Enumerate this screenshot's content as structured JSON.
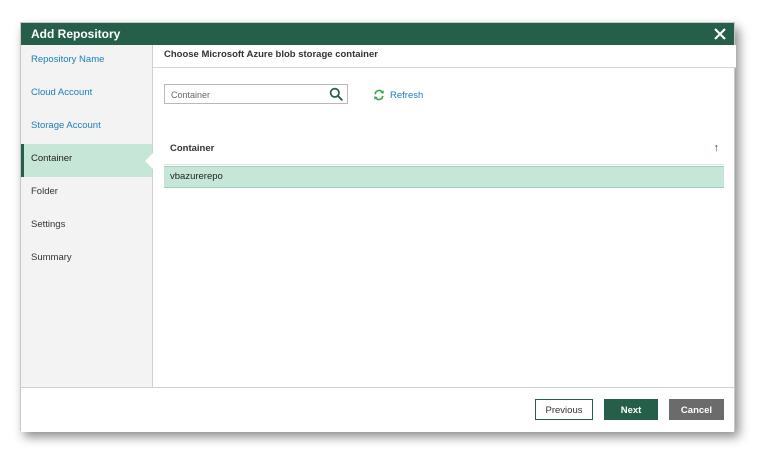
{
  "dialog": {
    "title": "Add Repository",
    "accent_color": "#255f4a"
  },
  "sidebar": {
    "items": [
      {
        "label": "Repository Name",
        "state": "done"
      },
      {
        "label": "Cloud Account",
        "state": "done"
      },
      {
        "label": "Storage Account",
        "state": "done"
      },
      {
        "label": "Container",
        "state": "active"
      },
      {
        "label": "Folder",
        "state": "pending"
      },
      {
        "label": "Settings",
        "state": "pending"
      },
      {
        "label": "Summary",
        "state": "pending"
      }
    ]
  },
  "main": {
    "heading": "Choose Microsoft Azure blob storage container",
    "search": {
      "placeholder": "Container",
      "value": "",
      "icon": "search-icon"
    },
    "refresh": {
      "label": "Refresh",
      "icon": "refresh-icon"
    },
    "table": {
      "columns": [
        "Container"
      ],
      "sort": "ascending",
      "rows": [
        {
          "container": "vbazurerepo",
          "selected": true
        }
      ]
    }
  },
  "footer": {
    "previous_label": "Previous",
    "next_label": "Next",
    "cancel_label": "Cancel"
  }
}
